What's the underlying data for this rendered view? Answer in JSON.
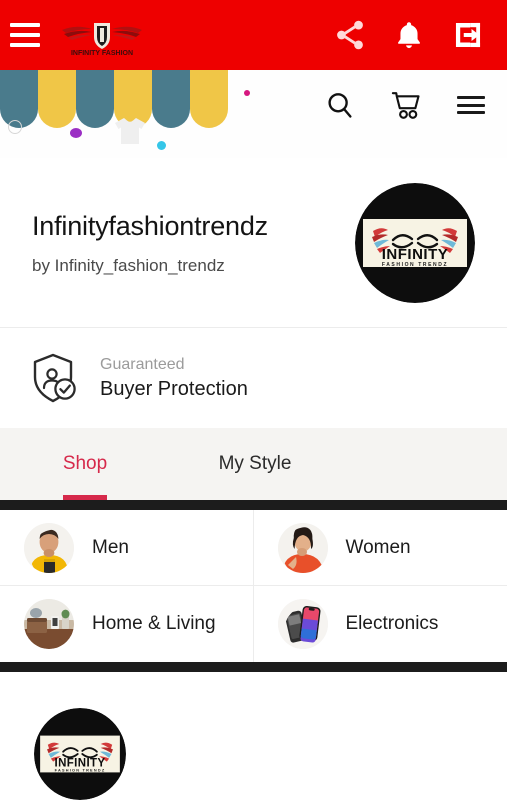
{
  "appbar": {
    "menu_icon": "hamburger-menu-icon",
    "logo_text": "INFINITY FASHION",
    "share_icon": "share-icon",
    "notification_icon": "bell-icon",
    "logout_icon": "logout-icon",
    "background_color": "#ee0000"
  },
  "banner": {
    "search_icon": "search-icon",
    "cart_icon": "shopping-cart-icon",
    "menu_icon": "hamburger-menu-icon",
    "awning_colors": [
      "#4a7b8c",
      "#f0c647",
      "#4a7b8c",
      "#f0c647",
      "#4a7b8c",
      "#f0c647"
    ],
    "decor": [
      {
        "name": "ring-outline",
        "color": "#d7d7d7"
      },
      {
        "name": "purple-dot",
        "color": "#9b2fc4"
      },
      {
        "name": "cyan-dot",
        "color": "#35c6e8"
      },
      {
        "name": "magenta-dot",
        "color": "#d6187f"
      },
      {
        "name": "tshirt-shape",
        "color": "#efefef"
      }
    ]
  },
  "store": {
    "name": "Infinityfashiontrendz",
    "by_line": "by Infinity_fashion_trendz",
    "avatar_name": "INFINITY",
    "avatar_subtitle": "FASHION TRENDZ"
  },
  "protection": {
    "icon": "shield-check-icon",
    "top_label": "Guaranteed",
    "main_label": "Buyer Protection"
  },
  "tabs": {
    "active_index": 0,
    "accent_color": "#d6294b",
    "items": [
      {
        "label": "Shop"
      },
      {
        "label": "My Style"
      }
    ]
  },
  "categories": [
    {
      "label": "Men",
      "thumb": "men-category-thumb"
    },
    {
      "label": "Women",
      "thumb": "women-category-thumb"
    },
    {
      "label": "Home & Living",
      "thumb": "home-living-category-thumb"
    },
    {
      "label": "Electronics",
      "thumb": "electronics-category-thumb"
    }
  ],
  "footer": {
    "logo_name": "INFINITY",
    "logo_subtitle": "FASHION TRENDZ"
  }
}
